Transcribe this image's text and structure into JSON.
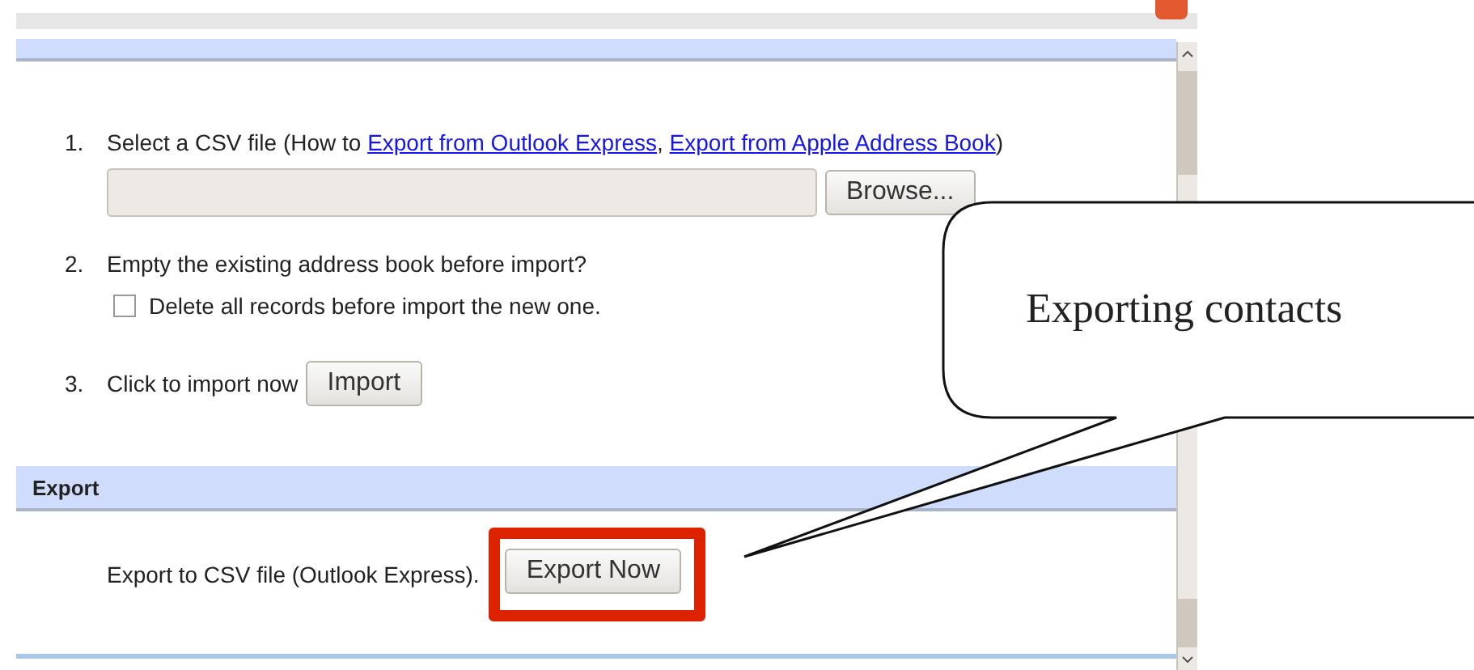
{
  "import_section": {
    "steps": [
      {
        "number": "1.",
        "kind": "file",
        "text": "Select a CSV file (How to ",
        "links": [
          "Export from Outlook Express",
          "Export from Apple Address Book"
        ],
        "separator": ", ",
        "suffix": ")",
        "button": "Browse..."
      },
      {
        "number": "2.",
        "kind": "checkbox",
        "text": "Empty the existing address book before import?",
        "option": {
          "label": "Delete all records before import the new one.",
          "checked": false
        }
      },
      {
        "number": "3.",
        "kind": "button",
        "text": "Click to import now",
        "button": "Import"
      }
    ]
  },
  "export_section": {
    "title": "Export",
    "text": "Export to CSV file (Outlook Express).",
    "button": "Export Now",
    "highlighted": true
  },
  "callout": {
    "text": "Exporting contacts"
  }
}
